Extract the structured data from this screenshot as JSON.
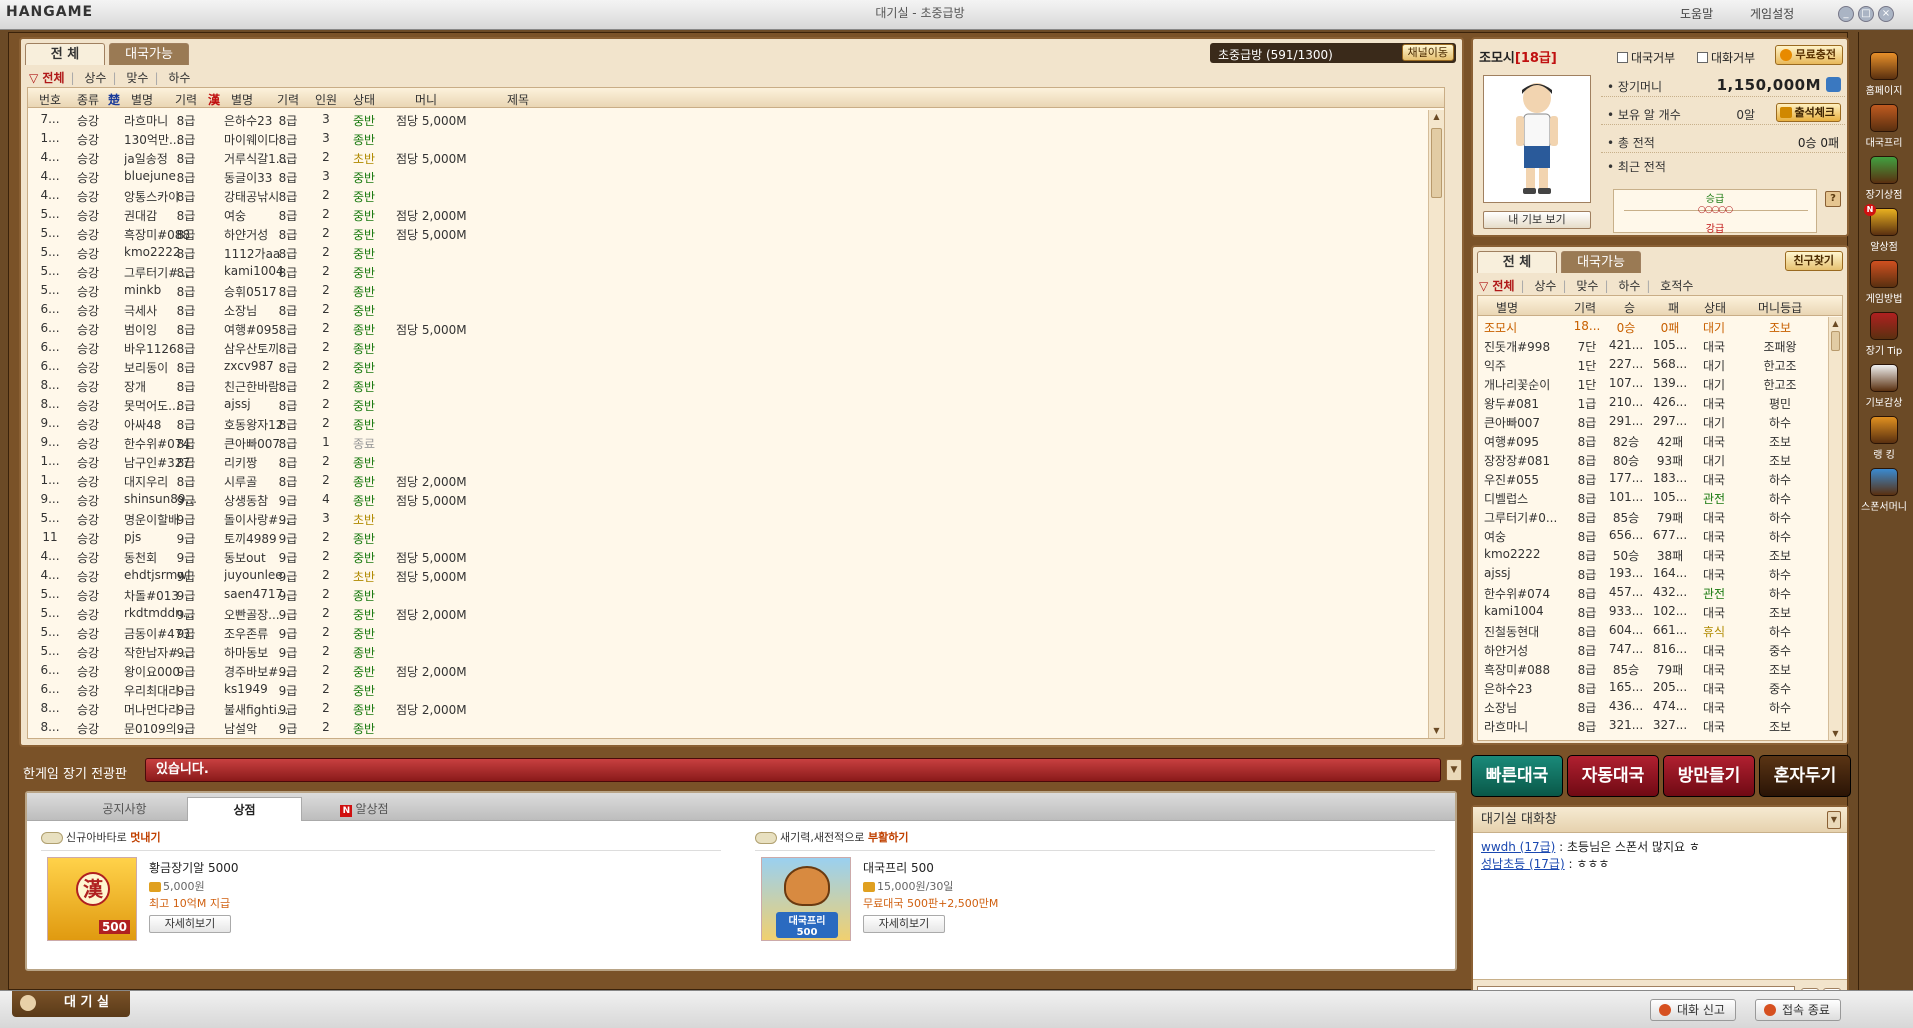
{
  "titlebar": {
    "logo": "HANGAME",
    "title": "대기실 - 초중급방",
    "help": "도움말",
    "settings": "게임설정",
    "min": "_",
    "max": "□",
    "close": "×"
  },
  "room_tabs": [
    {
      "label": "전 체",
      "active": true
    },
    {
      "label": "대국가능",
      "active": false
    }
  ],
  "room_title": "초중급방 (591/1300)",
  "channel_button": "채널이동",
  "room_filters": {
    "selected": "전체",
    "items": [
      "상수",
      "맞수",
      "하수"
    ]
  },
  "room_columns": {
    "no": "번호",
    "type": "종류",
    "chu_icon": "楚",
    "nick1": "별명",
    "grade1": "기력",
    "han_icon": "漢",
    "nick2": "별명",
    "grade2": "기력",
    "people": "인원",
    "status": "상태",
    "money": "머니",
    "subject": "제목"
  },
  "rooms": [
    {
      "no": "7...",
      "type": "승강",
      "n1": "라흐마니",
      "g1": "8급",
      "n2": "은하수23",
      "g2": "8급",
      "p": "3",
      "st": "중반",
      "m": "점당 5,000M"
    },
    {
      "no": "1...",
      "type": "승강",
      "n1": "130억만...",
      "g1": "8급",
      "n2": "마이웨이다",
      "g2": "8급",
      "p": "3",
      "st": "종반",
      "m": ""
    },
    {
      "no": "4...",
      "type": "승강",
      "n1": "ja일송정",
      "g1": "8급",
      "n2": "거루식갈1...",
      "g2": "8급",
      "p": "2",
      "st": "초반",
      "m": "점당 5,000M"
    },
    {
      "no": "4...",
      "type": "승강",
      "n1": "bluejune",
      "g1": "8급",
      "n2": "동글이33",
      "g2": "8급",
      "p": "3",
      "st": "중반",
      "m": ""
    },
    {
      "no": "4...",
      "type": "승강",
      "n1": "앙통스카이",
      "g1": "8급",
      "n2": "강태공낚시",
      "g2": "8급",
      "p": "2",
      "st": "중반",
      "m": ""
    },
    {
      "no": "5...",
      "type": "승강",
      "n1": "권대감",
      "g1": "8급",
      "n2": "여숭",
      "g2": "8급",
      "p": "2",
      "st": "중반",
      "m": "점당 2,000M"
    },
    {
      "no": "5...",
      "type": "승강",
      "n1": "흑장미#088",
      "g1": "8급",
      "n2": "하얀거성",
      "g2": "8급",
      "p": "2",
      "st": "중반",
      "m": "점당 5,000M"
    },
    {
      "no": "5...",
      "type": "승강",
      "n1": "kmo2222",
      "g1": "8급",
      "n2": "1112가aa",
      "g2": "8급",
      "p": "2",
      "st": "중반",
      "m": ""
    },
    {
      "no": "5...",
      "type": "승강",
      "n1": "그루터기#...",
      "g1": "8급",
      "n2": "kami1004",
      "g2": "8급",
      "p": "2",
      "st": "중반",
      "m": ""
    },
    {
      "no": "5...",
      "type": "승강",
      "n1": "minkb",
      "g1": "8급",
      "n2": "승휘0517",
      "g2": "8급",
      "p": "2",
      "st": "종반",
      "m": ""
    },
    {
      "no": "6...",
      "type": "승강",
      "n1": "극세사",
      "g1": "8급",
      "n2": "소장님",
      "g2": "8급",
      "p": "2",
      "st": "중반",
      "m": ""
    },
    {
      "no": "6...",
      "type": "승강",
      "n1": "범이잉",
      "g1": "8급",
      "n2": "여행#095",
      "g2": "8급",
      "p": "2",
      "st": "종반",
      "m": "점당 5,000M"
    },
    {
      "no": "6...",
      "type": "승강",
      "n1": "바우1126",
      "g1": "8급",
      "n2": "삼우산토끼",
      "g2": "8급",
      "p": "2",
      "st": "종반",
      "m": ""
    },
    {
      "no": "6...",
      "type": "승강",
      "n1": "보리동이",
      "g1": "8급",
      "n2": "zxcv987",
      "g2": "8급",
      "p": "2",
      "st": "중반",
      "m": ""
    },
    {
      "no": "8...",
      "type": "승강",
      "n1": "장개",
      "g1": "8급",
      "n2": "친근한바람",
      "g2": "8급",
      "p": "2",
      "st": "종반",
      "m": ""
    },
    {
      "no": "8...",
      "type": "승강",
      "n1": "못먹어도...",
      "g1": "8급",
      "n2": "ajssj",
      "g2": "8급",
      "p": "2",
      "st": "중반",
      "m": ""
    },
    {
      "no": "9...",
      "type": "승강",
      "n1": "아싸48",
      "g1": "8급",
      "n2": "호동왕자12",
      "g2": "8급",
      "p": "2",
      "st": "종반",
      "m": ""
    },
    {
      "no": "9...",
      "type": "승강",
      "n1": "한수위#074",
      "g1": "8급",
      "n2": "큰아빠007",
      "g2": "8급",
      "p": "1",
      "st": "종료",
      "m": ""
    },
    {
      "no": "1...",
      "type": "승강",
      "n1": "남구인#327",
      "g1": "8급",
      "n2": "리키짱",
      "g2": "8급",
      "p": "2",
      "st": "종반",
      "m": ""
    },
    {
      "no": "1...",
      "type": "승강",
      "n1": "대지우리",
      "g1": "8급",
      "n2": "시루골",
      "g2": "8급",
      "p": "2",
      "st": "종반",
      "m": "점당 2,000M"
    },
    {
      "no": "9...",
      "type": "승강",
      "n1": "shinsun89...",
      "g1": "9급",
      "n2": "상생동참",
      "g2": "9급",
      "p": "4",
      "st": "종반",
      "m": "점당 5,000M"
    },
    {
      "no": "5...",
      "type": "승강",
      "n1": "명운이할배",
      "g1": "9급",
      "n2": "돌이사랑#...",
      "g2": "9급",
      "p": "3",
      "st": "초반",
      "m": ""
    },
    {
      "no": "11",
      "type": "승강",
      "n1": "pjs",
      "g1": "9급",
      "n2": "토끼4989",
      "g2": "9급",
      "p": "2",
      "st": "종반",
      "m": ""
    },
    {
      "no": "4...",
      "type": "승강",
      "n1": "동천회",
      "g1": "9급",
      "n2": "동보out",
      "g2": "9급",
      "p": "2",
      "st": "중반",
      "m": "점당 5,000M"
    },
    {
      "no": "4...",
      "type": "승강",
      "n1": "ehdtjsrmwl",
      "g1": "9급",
      "n2": "juyounlee",
      "g2": "9급",
      "p": "2",
      "st": "초반",
      "m": "점당 5,000M"
    },
    {
      "no": "5...",
      "type": "승강",
      "n1": "차돌#013",
      "g1": "9급",
      "n2": "saen4717",
      "g2": "9급",
      "p": "2",
      "st": "종반",
      "m": ""
    },
    {
      "no": "5...",
      "type": "승강",
      "n1": "rkdtmddn...",
      "g1": "9급",
      "n2": "오빤골장...",
      "g2": "9급",
      "p": "2",
      "st": "중반",
      "m": "점당 2,000M"
    },
    {
      "no": "5...",
      "type": "승강",
      "n1": "금동이#473",
      "g1": "9급",
      "n2": "조우존류",
      "g2": "9급",
      "p": "2",
      "st": "중반",
      "m": ""
    },
    {
      "no": "5...",
      "type": "승강",
      "n1": "작한남자#...",
      "g1": "9급",
      "n2": "하마동보",
      "g2": "9급",
      "p": "2",
      "st": "종반",
      "m": ""
    },
    {
      "no": "6...",
      "type": "승강",
      "n1": "왕이요000",
      "g1": "9급",
      "n2": "경주바보#...",
      "g2": "9급",
      "p": "2",
      "st": "중반",
      "m": "점당 2,000M"
    },
    {
      "no": "6...",
      "type": "승강",
      "n1": "우리최대리",
      "g1": "9급",
      "n2": "ks1949",
      "g2": "9급",
      "p": "2",
      "st": "중반",
      "m": ""
    },
    {
      "no": "8...",
      "type": "승강",
      "n1": "머나먼다리",
      "g1": "9급",
      "n2": "불새fighti...",
      "g2": "9급",
      "p": "2",
      "st": "종반",
      "m": "점당 2,000M"
    },
    {
      "no": "8...",
      "type": "승강",
      "n1": "문0109의...",
      "g1": "9급",
      "n2": "남설악",
      "g2": "9급",
      "p": "2",
      "st": "종반",
      "m": ""
    }
  ],
  "notice": {
    "label": "한게임 장기 전광판",
    "message": "있습니다."
  },
  "shop": {
    "tabs": [
      "공지사항",
      "상점",
      "알상점"
    ],
    "new_badge": "N",
    "sections": [
      {
        "header_pre": "신규아바타로 ",
        "header_hl": "멋내기",
        "product": "황금장기알 5000",
        "price": "5,000원",
        "promo": "최고 10억M 지급",
        "button": "자세히보기",
        "img_text": "漢",
        "img_sub": "500"
      },
      {
        "header_pre": "새기력,새전적으로 ",
        "header_hl": "부활하기",
        "product": "대국프리 500",
        "price": "15,000원/30일",
        "promo": "무료대국 500판+2,500만M",
        "button": "자세히보기",
        "img_text": "대국프리",
        "img_sub": "500"
      }
    ]
  },
  "profile": {
    "name": "조모시",
    "level": "[18급]",
    "refuse_game": "대국거부",
    "refuse_chat": "대화거부",
    "free_charge": "무료충전",
    "money_label": "장기머니",
    "money_value": "1,150,000M",
    "eggs_label": "보유 알 개수",
    "eggs_value": "0알",
    "attend_button": "출석체크",
    "record_label": "총 전적",
    "record_value": "0승 0패",
    "recent_label": "최근 전적",
    "gibo_button": "내 기보 보기",
    "grade_up": "승급",
    "grade_down": "강급",
    "grade_dots": "○○○○○",
    "help_q": "?"
  },
  "user_tabs": [
    {
      "label": "전 체",
      "active": true
    },
    {
      "label": "대국가능",
      "active": false
    }
  ],
  "find_friend": "친구찾기",
  "user_filters": {
    "selected": "전체",
    "items": [
      "상수",
      "맞수",
      "하수",
      "호적수"
    ]
  },
  "user_columns": {
    "nick": "별명",
    "grade": "기력",
    "win": "승",
    "loss": "패",
    "status": "상태",
    "money": "머니등급"
  },
  "users": [
    {
      "n": "조모시",
      "g": "18...",
      "w": "0승",
      "l": "0패",
      "s": "대기",
      "m": "조보",
      "me": true
    },
    {
      "n": "진돗개#998",
      "g": "7단",
      "w": "421...",
      "l": "105...",
      "s": "대국",
      "m": "조패왕"
    },
    {
      "n": "익주",
      "g": "1단",
      "w": "227...",
      "l": "568...",
      "s": "대기",
      "m": "한고조"
    },
    {
      "n": "개나리꽃순이",
      "g": "1단",
      "w": "107...",
      "l": "139...",
      "s": "대기",
      "m": "한고조"
    },
    {
      "n": "왕두#081",
      "g": "1급",
      "w": "210...",
      "l": "426...",
      "s": "대국",
      "m": "평민"
    },
    {
      "n": "큰아빠007",
      "g": "8급",
      "w": "291...",
      "l": "297...",
      "s": "대기",
      "m": "하수"
    },
    {
      "n": "여행#095",
      "g": "8급",
      "w": "82승",
      "l": "42패",
      "s": "대국",
      "m": "조보"
    },
    {
      "n": "장장장#081",
      "g": "8급",
      "w": "80승",
      "l": "93패",
      "s": "대기",
      "m": "조보"
    },
    {
      "n": "우진#055",
      "g": "8급",
      "w": "177...",
      "l": "183...",
      "s": "대국",
      "m": "하수"
    },
    {
      "n": "디벨럽스",
      "g": "8급",
      "w": "101...",
      "l": "105...",
      "s": "관전",
      "m": "하수"
    },
    {
      "n": "그루터기#0...",
      "g": "8급",
      "w": "85승",
      "l": "79패",
      "s": "대국",
      "m": "하수"
    },
    {
      "n": "여숭",
      "g": "8급",
      "w": "656...",
      "l": "677...",
      "s": "대국",
      "m": "하수"
    },
    {
      "n": "kmo2222",
      "g": "8급",
      "w": "50승",
      "l": "38패",
      "s": "대국",
      "m": "조보"
    },
    {
      "n": "ajssj",
      "g": "8급",
      "w": "193...",
      "l": "164...",
      "s": "대국",
      "m": "하수"
    },
    {
      "n": "한수위#074",
      "g": "8급",
      "w": "457...",
      "l": "432...",
      "s": "관전",
      "m": "하수"
    },
    {
      "n": "kami1004",
      "g": "8급",
      "w": "933...",
      "l": "102...",
      "s": "대국",
      "m": "조보"
    },
    {
      "n": "진철동현대",
      "g": "8급",
      "w": "604...",
      "l": "661...",
      "s": "휴식",
      "m": "하수"
    },
    {
      "n": "하얀거성",
      "g": "8급",
      "w": "747...",
      "l": "816...",
      "s": "대국",
      "m": "중수"
    },
    {
      "n": "흑장미#088",
      "g": "8급",
      "w": "85승",
      "l": "79패",
      "s": "대국",
      "m": "조보"
    },
    {
      "n": "은하수23",
      "g": "8급",
      "w": "165...",
      "l": "205...",
      "s": "대국",
      "m": "중수"
    },
    {
      "n": "소장님",
      "g": "8급",
      "w": "436...",
      "l": "474...",
      "s": "대국",
      "m": "하수"
    },
    {
      "n": "라흐마니",
      "g": "8급",
      "w": "321...",
      "l": "327...",
      "s": "대국",
      "m": "조보"
    }
  ],
  "actions": {
    "quick": "빠른대국",
    "auto": "자동대국",
    "make": "방만들기",
    "solo": "혼자두기"
  },
  "chat": {
    "title": "대기실 대화창",
    "messages": [
      {
        "user": "wwdh (17급)",
        "text": " : 초등님은 스폰서 많지요 ㅎ"
      },
      {
        "user": "성남초등 (17급)",
        "text": " : ㅎㅎㅎ"
      }
    ],
    "emoji_icon": "▦",
    "report_icon": "⚑"
  },
  "sidebar": [
    {
      "label": "홈페이지",
      "color": "#e8902a",
      "icon": "home-icon"
    },
    {
      "label": "대국프리",
      "color": "#c05a20",
      "icon": "free-play-icon"
    },
    {
      "label": "장기상점",
      "color": "#40a040",
      "icon": "shop-icon"
    },
    {
      "label": "알상점",
      "color": "#e8b020",
      "icon": "egg-shop-icon",
      "badge": "N"
    },
    {
      "label": "게임방법",
      "color": "#d05020",
      "icon": "howto-icon"
    },
    {
      "label": "장기 Tip",
      "color": "#b02020",
      "icon": "tip-icon"
    },
    {
      "label": "기보감상",
      "color": "#f0f0f0",
      "icon": "gibo-icon"
    },
    {
      "label": "랭 킹",
      "color": "#e09020",
      "icon": "ranking-icon"
    },
    {
      "label": "스폰서머니",
      "color": "#3a8ad0",
      "icon": "sponsor-icon"
    }
  ],
  "bottombar": {
    "room_tab": "대 기 실",
    "report": "대화 신고",
    "exit": "접속 종료"
  }
}
